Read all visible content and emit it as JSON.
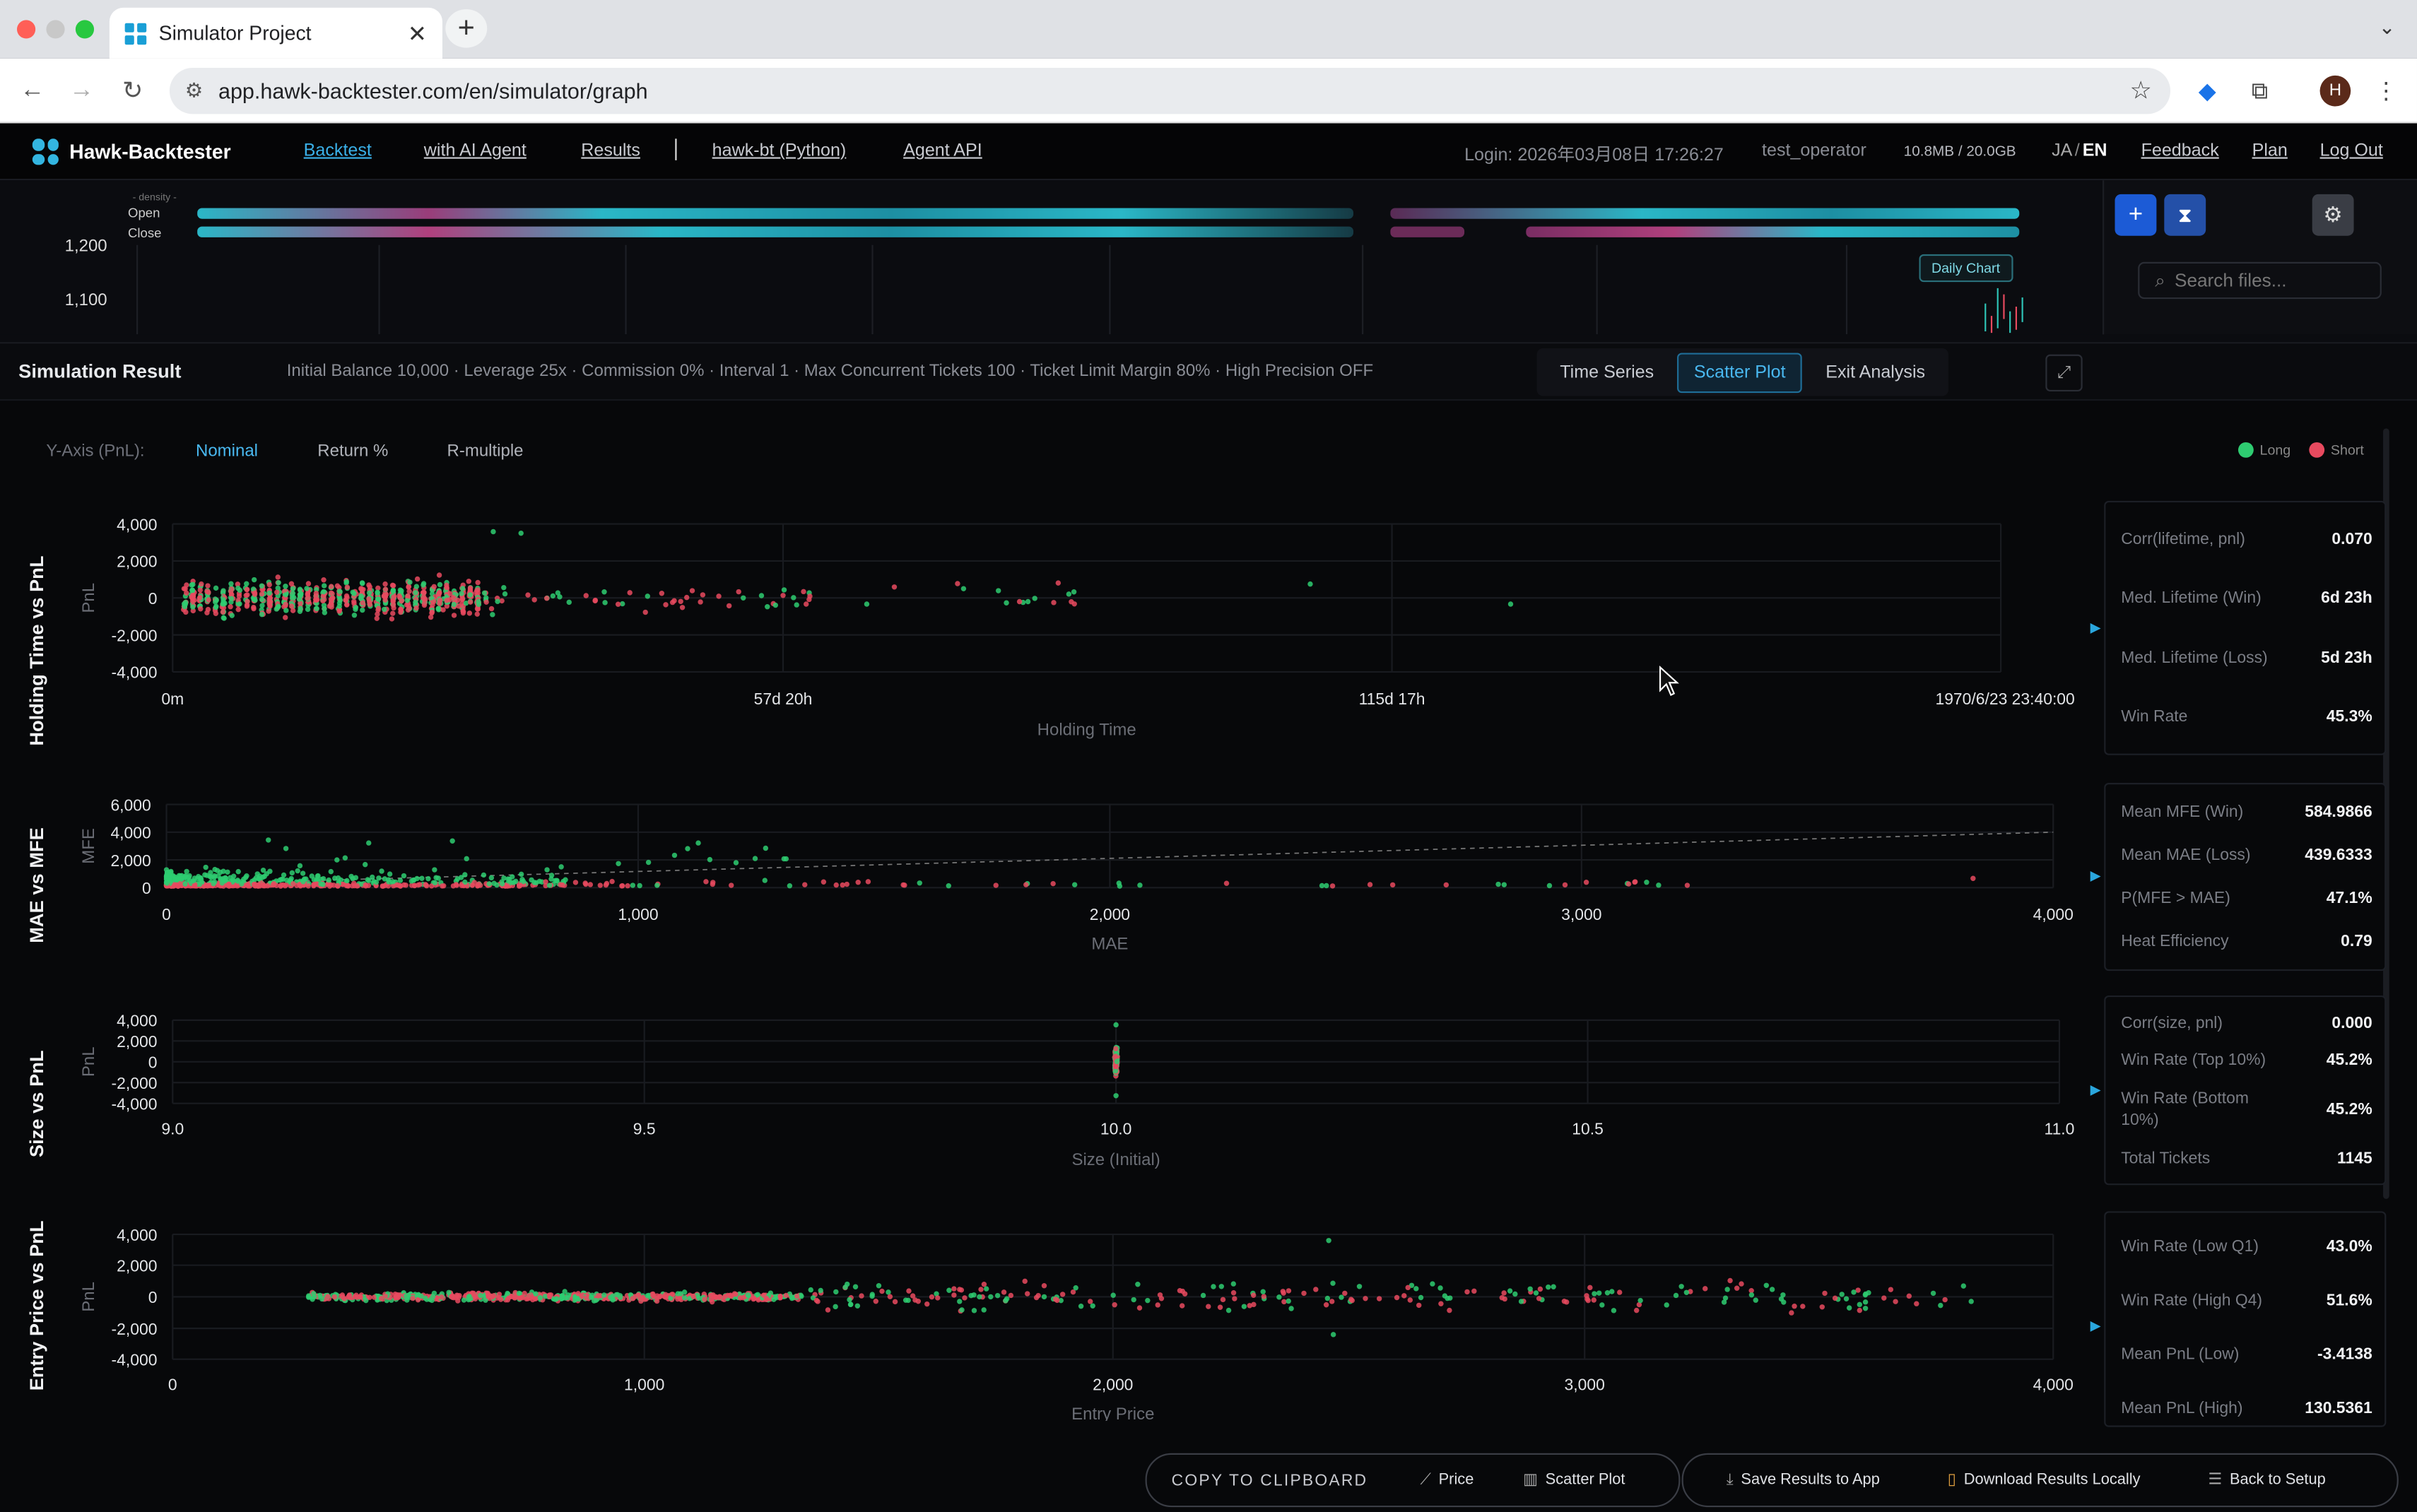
{
  "browser": {
    "tab_title": "Simulator Project",
    "url": "app.hawk-backtester.com/en/simulator/graph"
  },
  "nav": {
    "logo": "Hawk-Backtester",
    "links": [
      "Backtest",
      "with AI Agent",
      "Results",
      "hawk-bt (Python)",
      "Agent API"
    ],
    "login": "Login: 2026年03月08日 17:26:27",
    "user": "test_operator",
    "storage": "10.8MB / 20.0GB",
    "lang_ja": "JA",
    "lang_sep": "/",
    "lang_en": "EN",
    "right_links": [
      "Feedback",
      "Plan",
      "Log Out"
    ]
  },
  "top_chart": {
    "density_label": "- density -",
    "open_label": "Open",
    "close_label": "Close",
    "y_ticks": [
      "1,200",
      "1,100"
    ],
    "daily_chart": "Daily Chart",
    "search_placeholder": "Search files..."
  },
  "result": {
    "title": "Simulation Result",
    "summary": "Initial Balance 10,000 · Leverage 25x · Commission 0% · Interval 1 · Max Concurrent Tickets 100 · Ticket Limit Margin 80% · High Precision OFF",
    "tabs": [
      "Time Series",
      "Scatter Plot",
      "Exit Analysis"
    ],
    "active_tab": "Scatter Plot",
    "y_axis_label": "Y-Axis (PnL):",
    "y_modes": [
      "Nominal",
      "Return %",
      "R-multiple"
    ],
    "active_y_mode": "Nominal",
    "legend": {
      "long": "Long",
      "short": "Short"
    },
    "colors": {
      "long": "#2ecc71",
      "short": "#e84a5f",
      "accent": "#49b8f0"
    }
  },
  "chart_data": [
    {
      "type": "scatter",
      "title": "Holding Time vs PnL",
      "xlabel": "Holding Time",
      "ylabel": "PnL",
      "x_ticks": [
        "0m",
        "57d 20h",
        "115d 17h",
        "1970/6/23 23:40:00"
      ],
      "y_ticks": [
        "4,000",
        "2,000",
        "0",
        "-2,000",
        "-4,000"
      ],
      "ylim": [
        -4000,
        4000
      ]
    },
    {
      "type": "scatter",
      "title": "MAE vs MFE",
      "xlabel": "MAE",
      "ylabel": "MFE",
      "x_ticks": [
        "0",
        "1,000",
        "2,000",
        "3,000",
        "4,000"
      ],
      "y_ticks": [
        "6,000",
        "4,000",
        "2,000",
        "0"
      ],
      "xlim": [
        0,
        4000
      ],
      "ylim": [
        0,
        6000
      ]
    },
    {
      "type": "scatter",
      "title": "Size vs PnL",
      "xlabel": "Size (Initial)",
      "ylabel": "PnL",
      "x_ticks": [
        "9.0",
        "9.5",
        "10.0",
        "10.5",
        "11.0"
      ],
      "y_ticks": [
        "4,000",
        "2,000",
        "0",
        "-2,000",
        "-4,000"
      ],
      "xlim": [
        9,
        11
      ],
      "ylim": [
        -4000,
        4000
      ]
    },
    {
      "type": "scatter",
      "title": "Entry Price vs PnL",
      "xlabel": "Entry Price",
      "ylabel": "PnL",
      "x_ticks": [
        "0",
        "1,000",
        "2,000",
        "3,000",
        "4,000"
      ],
      "y_ticks": [
        "4,000",
        "2,000",
        "0",
        "-2,000",
        "-4,000"
      ],
      "xlim": [
        0,
        4000
      ],
      "ylim": [
        -4000,
        4000
      ]
    }
  ],
  "stats": [
    [
      {
        "k": "Corr(lifetime, pnl)",
        "v": "0.070"
      },
      {
        "k": "Med. Lifetime (Win)",
        "v": "6d 23h"
      },
      {
        "k": "Med. Lifetime (Loss)",
        "v": "5d 23h"
      },
      {
        "k": "Win Rate",
        "v": "45.3%"
      }
    ],
    [
      {
        "k": "Mean MFE (Win)",
        "v": "584.9866"
      },
      {
        "k": "Mean MAE (Loss)",
        "v": "439.6333"
      },
      {
        "k": "P(MFE > MAE)",
        "v": "47.1%"
      },
      {
        "k": "Heat Efficiency",
        "v": "0.79"
      }
    ],
    [
      {
        "k": "Corr(size, pnl)",
        "v": "0.000"
      },
      {
        "k": "Win Rate (Top 10%)",
        "v": "45.2%"
      },
      {
        "k": "Win Rate (Bottom 10%)",
        "v": "45.2%"
      },
      {
        "k": "Total Tickets",
        "v": "1145"
      }
    ],
    [
      {
        "k": "Win Rate (Low Q1)",
        "v": "43.0%"
      },
      {
        "k": "Win Rate (High Q4)",
        "v": "51.6%"
      },
      {
        "k": "Mean PnL (Low)",
        "v": "-3.4138"
      },
      {
        "k": "Mean PnL (High)",
        "v": "130.5361"
      }
    ]
  ],
  "bottom": {
    "copy": "COPY TO CLIPBOARD",
    "price": "Price",
    "scatter": "Scatter Plot",
    "save": "Save Results to App",
    "download": "Download Results Locally",
    "back": "Back to Setup"
  }
}
